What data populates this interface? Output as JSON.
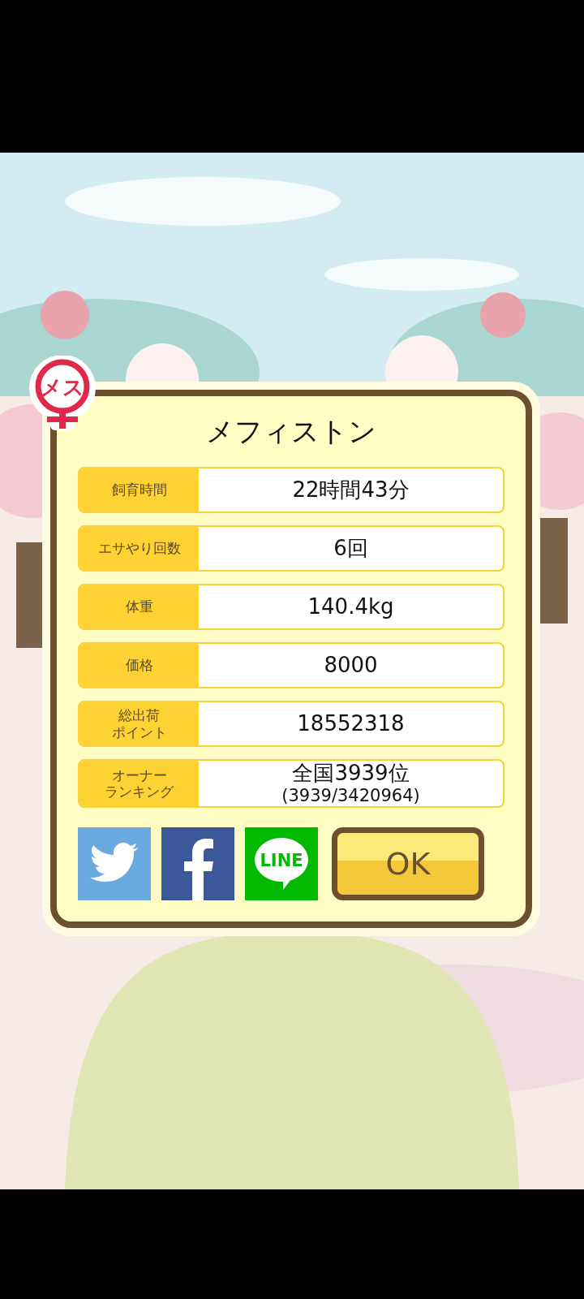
{
  "gender_badge": {
    "label": "メス"
  },
  "dialog": {
    "title": "メフィストン",
    "stats": [
      {
        "label_lines": [
          "飼育時間"
        ],
        "value": "22時間43分"
      },
      {
        "label_lines": [
          "エサやり回数"
        ],
        "value": "6回"
      },
      {
        "label_lines": [
          "体重"
        ],
        "value": "140.4kg"
      },
      {
        "label_lines": [
          "価格"
        ],
        "value": "8000"
      },
      {
        "label_lines": [
          "総出荷",
          "ポイント"
        ],
        "value": "18552318"
      },
      {
        "label_lines": [
          "オーナー",
          "ランキング"
        ],
        "value": "全国3939位",
        "sub_value": "(3939/3420964)"
      }
    ],
    "share_buttons": [
      {
        "kind": "twitter"
      },
      {
        "kind": "facebook"
      },
      {
        "kind": "line",
        "label": "LINE"
      }
    ],
    "ok_button": {
      "label": "OK"
    }
  }
}
